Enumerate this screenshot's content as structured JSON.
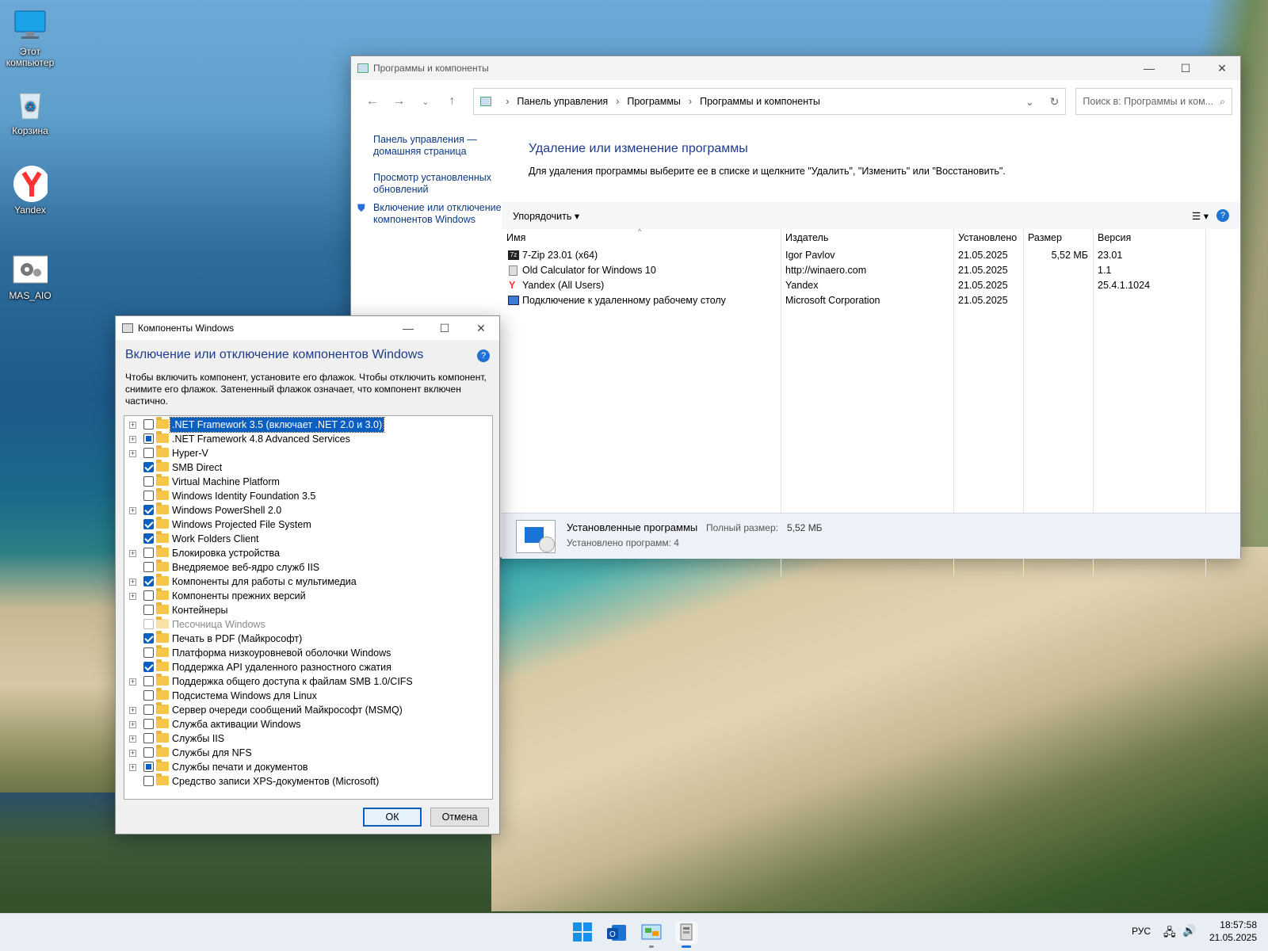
{
  "desktop": {
    "icons": [
      {
        "label": "Этот компьютер",
        "icon": "monitor-icon"
      },
      {
        "label": "Корзина",
        "icon": "recycle-bin-icon"
      },
      {
        "label": "Yandex",
        "icon": "yandex-icon"
      },
      {
        "label": "MAS_AIO",
        "icon": "settings-shortcut-icon"
      }
    ]
  },
  "cp_window": {
    "title": "Программы и компоненты",
    "breadcrumb": [
      "Панель управления",
      "Программы",
      "Программы и компоненты"
    ],
    "search_placeholder": "Поиск в: Программы и ком...",
    "left_links": [
      "Панель управления — домашняя страница",
      "Просмотр установленных обновлений",
      "Включение или отключение компонентов Windows"
    ],
    "heading": "Удаление или изменение программы",
    "subheading": "Для удаления программы выберите ее в списке и щелкните \"Удалить\", \"Изменить\" или \"Восстановить\".",
    "organize_label": "Упорядочить",
    "columns": [
      "Имя",
      "Издатель",
      "Установлено",
      "Размер",
      "Версия"
    ],
    "programs": [
      {
        "name": "7-Zip 23.01 (x64)",
        "publisher": "Igor Pavlov",
        "installed": "21.05.2025",
        "size": "5,52 МБ",
        "version": "23.01"
      },
      {
        "name": "Old Calculator for Windows 10",
        "publisher": "http://winaero.com",
        "installed": "21.05.2025",
        "size": "",
        "version": "1.1"
      },
      {
        "name": "Yandex (All Users)",
        "publisher": "Yandex",
        "installed": "21.05.2025",
        "size": "",
        "version": "25.4.1.1024"
      },
      {
        "name": "Подключение к удаленному рабочему столу",
        "publisher": "Microsoft Corporation",
        "installed": "21.05.2025",
        "size": "",
        "version": ""
      }
    ],
    "status_title": "Установленные программы",
    "status_size_label": "Полный размер:",
    "status_size_value": "5,52 МБ",
    "status_count": "Установлено программ: 4"
  },
  "features_dialog": {
    "title": "Компоненты Windows",
    "heading": "Включение или отключение компонентов Windows",
    "description": "Чтобы включить компонент, установите его флажок. Чтобы отключить компонент, снимите его флажок. Затененный флажок означает, что компонент включен частично.",
    "items": [
      {
        "label": ".NET Framework 3.5 (включает .NET 2.0 и 3.0)",
        "state": "off",
        "expandable": true,
        "selected": true
      },
      {
        "label": ".NET Framework 4.8 Advanced Services",
        "state": "partial",
        "expandable": true
      },
      {
        "label": "Hyper-V",
        "state": "off",
        "expandable": true
      },
      {
        "label": "SMB Direct",
        "state": "on",
        "expandable": false
      },
      {
        "label": "Virtual Machine Platform",
        "state": "off",
        "expandable": false
      },
      {
        "label": "Windows Identity Foundation 3.5",
        "state": "off",
        "expandable": false
      },
      {
        "label": "Windows PowerShell 2.0",
        "state": "on",
        "expandable": true
      },
      {
        "label": "Windows Projected File System",
        "state": "on",
        "expandable": false
      },
      {
        "label": "Work Folders Client",
        "state": "on",
        "expandable": false
      },
      {
        "label": "Блокировка устройства",
        "state": "off",
        "expandable": true
      },
      {
        "label": "Внедряемое веб-ядро служб IIS",
        "state": "off",
        "expandable": false
      },
      {
        "label": "Компоненты для работы с мультимедиа",
        "state": "on",
        "expandable": true
      },
      {
        "label": "Компоненты прежних версий",
        "state": "off",
        "expandable": true
      },
      {
        "label": "Контейнеры",
        "state": "off",
        "expandable": false
      },
      {
        "label": "Песочница Windows",
        "state": "disabled",
        "expandable": false
      },
      {
        "label": "Печать в PDF (Майкрософт)",
        "state": "on",
        "expandable": false
      },
      {
        "label": "Платформа низкоуровневой оболочки Windows",
        "state": "off",
        "expandable": false
      },
      {
        "label": "Поддержка API удаленного разностного сжатия",
        "state": "on",
        "expandable": false
      },
      {
        "label": "Поддержка общего доступа к файлам SMB 1.0/CIFS",
        "state": "off",
        "expandable": true
      },
      {
        "label": "Подсистема Windows для Linux",
        "state": "off",
        "expandable": false
      },
      {
        "label": "Сервер очереди сообщений Майкрософт (MSMQ)",
        "state": "off",
        "expandable": true
      },
      {
        "label": "Служба активации Windows",
        "state": "off",
        "expandable": true
      },
      {
        "label": "Службы IIS",
        "state": "off",
        "expandable": true
      },
      {
        "label": "Службы для NFS",
        "state": "off",
        "expandable": true
      },
      {
        "label": "Службы печати и документов",
        "state": "partial",
        "expandable": true
      },
      {
        "label": "Средство записи XPS-документов (Microsoft)",
        "state": "off",
        "expandable": false
      }
    ],
    "ok_label": "ОК",
    "cancel_label": "Отмена"
  },
  "taskbar": {
    "lang": "РУС",
    "time": "18:57:58",
    "date": "21.05.2025"
  }
}
